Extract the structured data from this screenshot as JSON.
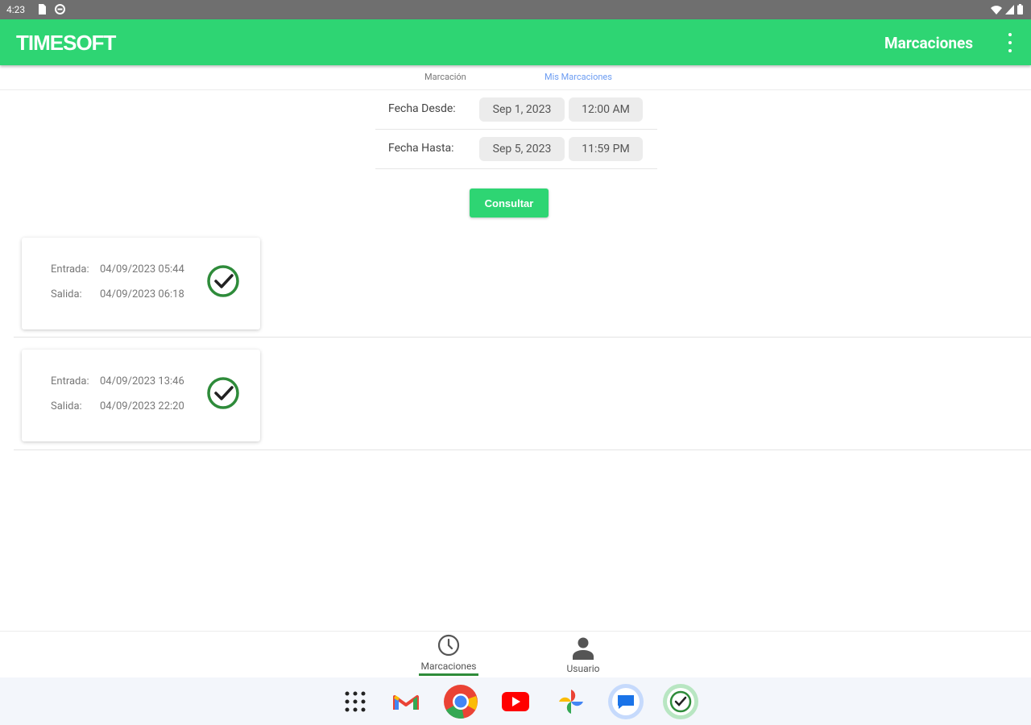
{
  "status_bar": {
    "time": "4:23"
  },
  "app_bar": {
    "logo": "TIMESOFT",
    "title": "Marcaciones"
  },
  "tabs": [
    {
      "label": "Marcación",
      "active": false
    },
    {
      "label": "Mis Marcaciones",
      "active": true
    }
  ],
  "filters": {
    "desde": {
      "label": "Fecha Desde:",
      "date": "Sep 1, 2023",
      "time": "12:00 AM"
    },
    "hasta": {
      "label": "Fecha Hasta:",
      "date": "Sep 5, 2023",
      "time": "11:59 PM"
    }
  },
  "consultar_label": "Consultar",
  "records": [
    {
      "entrada_label": "Entrada:",
      "entrada": "04/09/2023 05:44",
      "salida_label": "Salida:",
      "salida": "04/09/2023 06:18"
    },
    {
      "entrada_label": "Entrada:",
      "entrada": "04/09/2023 13:46",
      "salida_label": "Salida:",
      "salida": "04/09/2023 22:20"
    }
  ],
  "bottom_nav": [
    {
      "label": "Marcaciones",
      "icon": "clock-icon",
      "active": true
    },
    {
      "label": "Usuario",
      "icon": "person-icon",
      "active": false
    }
  ],
  "dock": [
    "app-drawer-icon",
    "gmail-icon",
    "chrome-icon",
    "youtube-icon",
    "photos-icon",
    "messages-icon",
    "timesoft-app-icon"
  ],
  "colors": {
    "accent": "#2ed573",
    "check": "#2e8b3a",
    "active_tab": "#6b9cf2"
  }
}
